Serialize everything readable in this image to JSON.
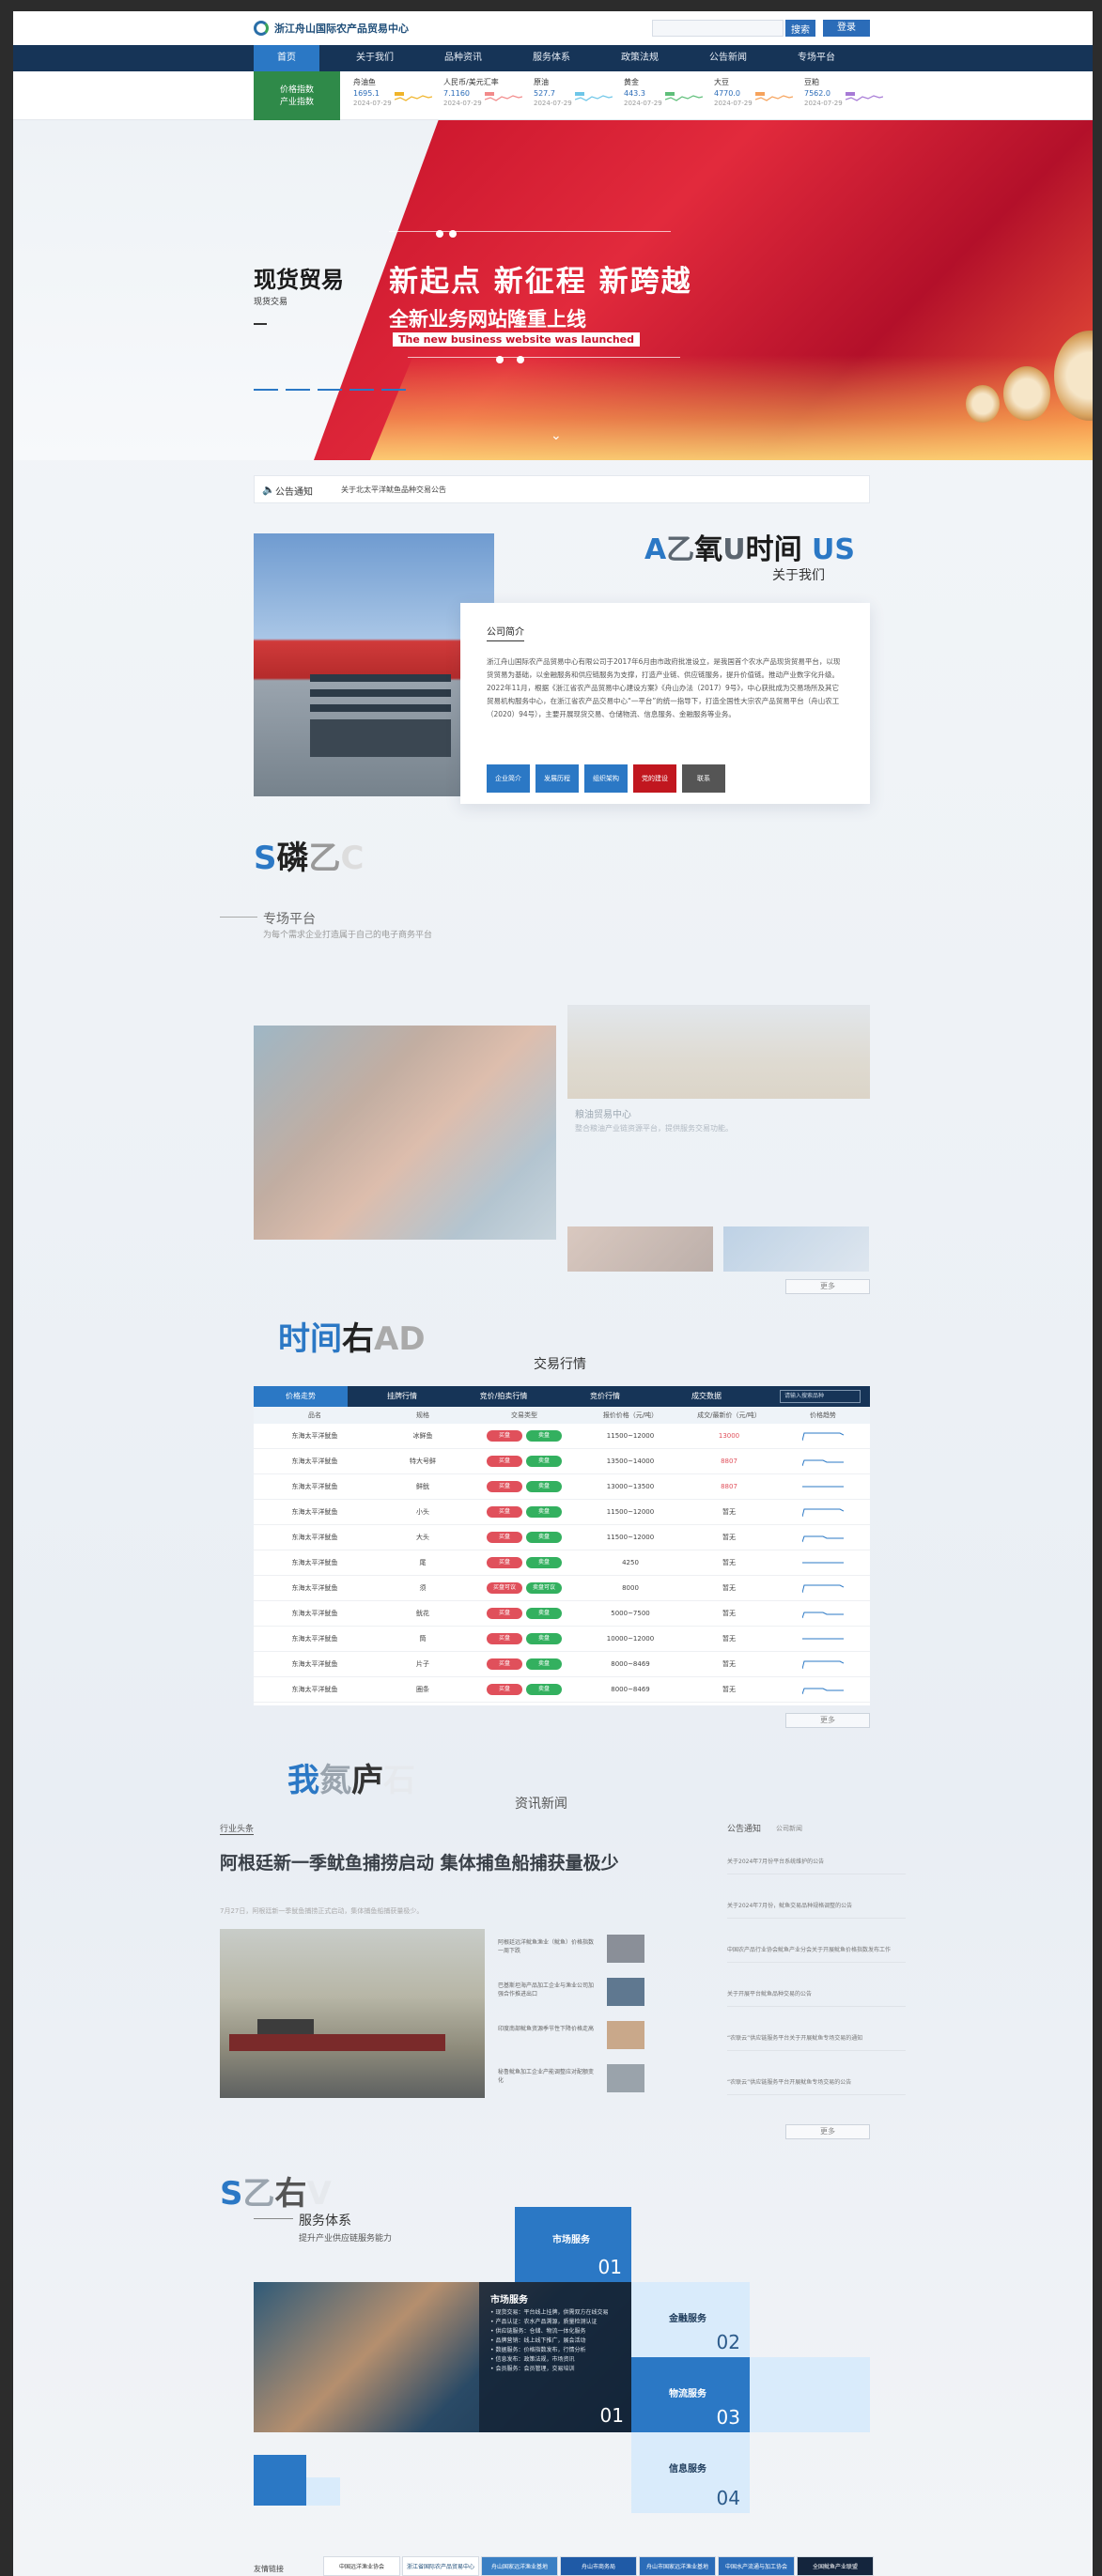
{
  "header": {
    "logo_text": "浙江舟山国际农产品贸易中心",
    "search_placeholder": "",
    "search_button": "搜索",
    "login_button": "登录"
  },
  "nav": {
    "items": [
      "首页",
      "关于我们",
      "品种资讯",
      "服务体系",
      "政策法规",
      "公告新闻",
      "专场平台"
    ]
  },
  "ticker": {
    "feature": [
      "价格指数",
      "产业指数"
    ],
    "items": [
      {
        "name": "舟油鱼",
        "price": "1695.1",
        "date": "2024-07-29",
        "color": "#f0b429"
      },
      {
        "name": "人民币/美元汇率",
        "price": "7.1160",
        "date": "2024-07-29",
        "color": "#f28a8a"
      },
      {
        "name": "原油",
        "price": "527.7",
        "date": "2024-07-29",
        "color": "#6ec6e8"
      },
      {
        "name": "黄金",
        "price": "443.3",
        "date": "2024-07-29",
        "color": "#5fbf7a"
      },
      {
        "name": "大豆",
        "price": "4770.0",
        "date": "2024-07-29",
        "color": "#f6a35c"
      },
      {
        "name": "豆粕",
        "price": "7562.0",
        "date": "2024-07-29",
        "color": "#a77ad6"
      }
    ]
  },
  "hero": {
    "left_title": "现货贸易",
    "left_sub": "现货交易",
    "main": "新起点  新征程  新跨越",
    "main2": "全新业务网站隆重上线",
    "english": "The new business website was launched"
  },
  "notice": {
    "label": "公告通知",
    "text": "关于北太平洋鱿鱼品种交易公告"
  },
  "about": {
    "heading_a": "A",
    "heading_b": "乙",
    "heading_c": "氧",
    "heading_d": "U",
    "heading_e": "时间",
    "heading_f": "US",
    "sub": "关于我们",
    "card_title": "公司简介",
    "card_body": "浙江舟山国际农产品贸易中心有限公司于2017年6月由市政府批准设立，是我国首个农水产品现货贸易平台，以现货贸易为基础，以金融服务和供应链服务为支撑，打造产业链、供应链服务，提升价值链。推动产业数字化升级。2022年11月，根据《浙江省农产品贸易中心建设方案》《舟山办法（2017）9号》，中心获批成为交易场所及其它贸易机构服务中心，在浙江省农产品交易中心“一平台”的统一指导下，打造全国性大宗农产品贸易平台（舟山农工（2020）94号），主要开展现货交易、仓储物流、信息服务、金融服务等业务。",
    "buttons": [
      "企业简介",
      "发展历程",
      "组织架构",
      "党的建设",
      "联系"
    ]
  },
  "platform": {
    "ghost": [
      "S",
      "磷",
      "乙",
      "C"
    ],
    "title": "专场平台",
    "desc": "为每个需求企业打造属于自己的电子商务平台",
    "field_title": "粮油贸易中心",
    "field_desc": "整合粮油产业链资源平台，提供服务交易功能。",
    "more": "更多"
  },
  "market": {
    "ghost": [
      "时间",
      "右",
      "AD"
    ],
    "title": "交易行情",
    "tabs": [
      "价格走势",
      "挂牌行情",
      "竞价/拍卖行情",
      "竞价行情",
      "成交数据"
    ],
    "search_placeholder": "请输入搜索品种",
    "columns": [
      "品名",
      "规格",
      "交易类型",
      "报价价格（元/吨）",
      "成交/最新价（元/吨）",
      "价格趋势"
    ],
    "rows": [
      {
        "name": "东海太平洋鱿鱼",
        "spec": "冰鲜鱼",
        "buy": "买盘",
        "sell": "卖盘",
        "price": "11500~12000",
        "last": "13000",
        "last_red": true
      },
      {
        "name": "东海太平洋鱿鱼",
        "spec": "特大号鲜",
        "buy": "买盘",
        "sell": "卖盘",
        "price": "13500~14000",
        "last": "8807",
        "last_red": true
      },
      {
        "name": "东海太平洋鱿鱼",
        "spec": "鲜鱿",
        "buy": "买盘",
        "sell": "卖盘",
        "price": "13000~13500",
        "last": "8807",
        "last_red": true
      },
      {
        "name": "东海太平洋鱿鱼",
        "spec": "小头",
        "buy": "买盘",
        "sell": "卖盘",
        "price": "11500~12000",
        "last": "暂无",
        "last_red": false
      },
      {
        "name": "东海太平洋鱿鱼",
        "spec": "大头",
        "buy": "买盘",
        "sell": "卖盘",
        "price": "11500~12000",
        "last": "暂无",
        "last_red": false
      },
      {
        "name": "东海太平洋鱿鱼",
        "spec": "尾",
        "buy": "买盘",
        "sell": "卖盘",
        "price": "4250",
        "last": "暂无",
        "last_red": false
      },
      {
        "name": "东海太平洋鱿鱼",
        "spec": "须",
        "buy": "买盘可议",
        "sell": "卖盘可议",
        "price": "8000",
        "last": "暂无",
        "last_red": false
      },
      {
        "name": "东海太平洋鱿鱼",
        "spec": "鱿花",
        "buy": "买盘",
        "sell": "卖盘",
        "price": "5000~7500",
        "last": "暂无",
        "last_red": false
      },
      {
        "name": "东海太平洋鱿鱼",
        "spec": "筒",
        "buy": "买盘",
        "sell": "卖盘",
        "price": "10000~12000",
        "last": "暂无",
        "last_red": false
      },
      {
        "name": "东海太平洋鱿鱼",
        "spec": "片子",
        "buy": "买盘",
        "sell": "卖盘",
        "price": "8000~8469",
        "last": "暂无",
        "last_red": false
      },
      {
        "name": "东海太平洋鱿鱼",
        "spec": "圈条",
        "buy": "买盘",
        "sell": "卖盘",
        "price": "8000~8469",
        "last": "暂无",
        "last_red": false
      }
    ],
    "more": "更多"
  },
  "news": {
    "ghost": [
      "我",
      "氮",
      "庐",
      "石"
    ],
    "title": "资讯新闻",
    "category": "行业头条",
    "headline": "阿根廷新一季鱿鱼捕捞启动 集体捕鱼船捕获量极少",
    "meta": "7月27日，阿根廷新一季鱿鱼捕捞正式启动，集体捕鱼船捕获量极少。",
    "items": [
      "阿根廷远洋鱿鱼渔业（鱿鱼）价格指数一周下跌",
      "巴基斯坦海产品加工企业与渔业公司加强合作推进出口",
      "印度南部鱿鱼资源季节性下降价格走高",
      "秘鲁鱿鱼加工企业产能调整应对配额变化"
    ],
    "bulletin_title": "公告通知",
    "bulletin_sub": "公司新闻",
    "bulletins": [
      "关于2024年7月份平台系统维护的公告",
      "关于2024年7月份，鱿鱼交易品种规格调整的公告",
      "中国农产品行业协会鱿鱼产业分会关于开展鱿鱼价格指数发布工作",
      "关于开展平台鱿鱼品种交易的公告",
      "“农联云”供应链服务平台关于开展鱿鱼专场交易的通知",
      "“农联云”供应链服务平台开展鱿鱼专场交易的公告"
    ],
    "more": "更多"
  },
  "service": {
    "ghost": [
      "S",
      "乙",
      "右",
      "V"
    ],
    "title": "服务体系",
    "desc": "提升产业供应链服务能力",
    "blocks": [
      {
        "label": "市场服务",
        "num": "01"
      },
      {
        "label": "金融服务",
        "num": "02"
      },
      {
        "label": "物流服务",
        "num": "03"
      },
      {
        "label": "信息服务",
        "num": "04"
      }
    ],
    "overlay_title": "市场服务",
    "overlay_list": [
      "• 现货交易：平台线上挂牌，供需双方在线交易",
      "• 产品认证：农水产品溯源，质量检测认证",
      "• 供应链服务：仓储、物流一体化服务",
      "• 品牌营销：线上线下推广，展会活动",
      "• 数据服务：价格指数发布，行情分析",
      "• 信息发布：政策法规，市场资讯",
      "• 会员服务：会员管理，交易培训"
    ],
    "overlay_num": "01"
  },
  "links": {
    "label": "友情链接",
    "items": [
      {
        "text": "中国远洋渔业协会",
        "bg": "#ffffff",
        "fg": "#333333"
      },
      {
        "text": "浙江省国际农产品贸易中心",
        "bg": "#ffffff",
        "fg": "#1f4e79"
      },
      {
        "text": "舟山国家远洋渔业基地",
        "bg": "#3a7fc4",
        "fg": "#ffffff"
      },
      {
        "text": "舟山市商务局",
        "bg": "#1f5aa6",
        "fg": "#ffffff"
      },
      {
        "text": "舟山市国家远洋渔业基地",
        "bg": "#2b6cb8",
        "fg": "#ffffff"
      },
      {
        "text": "中国水产流通与加工协会",
        "bg": "#2b6cb8",
        "fg": "#ffffff"
      },
      {
        "text": "全国鱿鱼产业联盟",
        "bg": "#14253d",
        "fg": "#ffffff"
      }
    ]
  }
}
